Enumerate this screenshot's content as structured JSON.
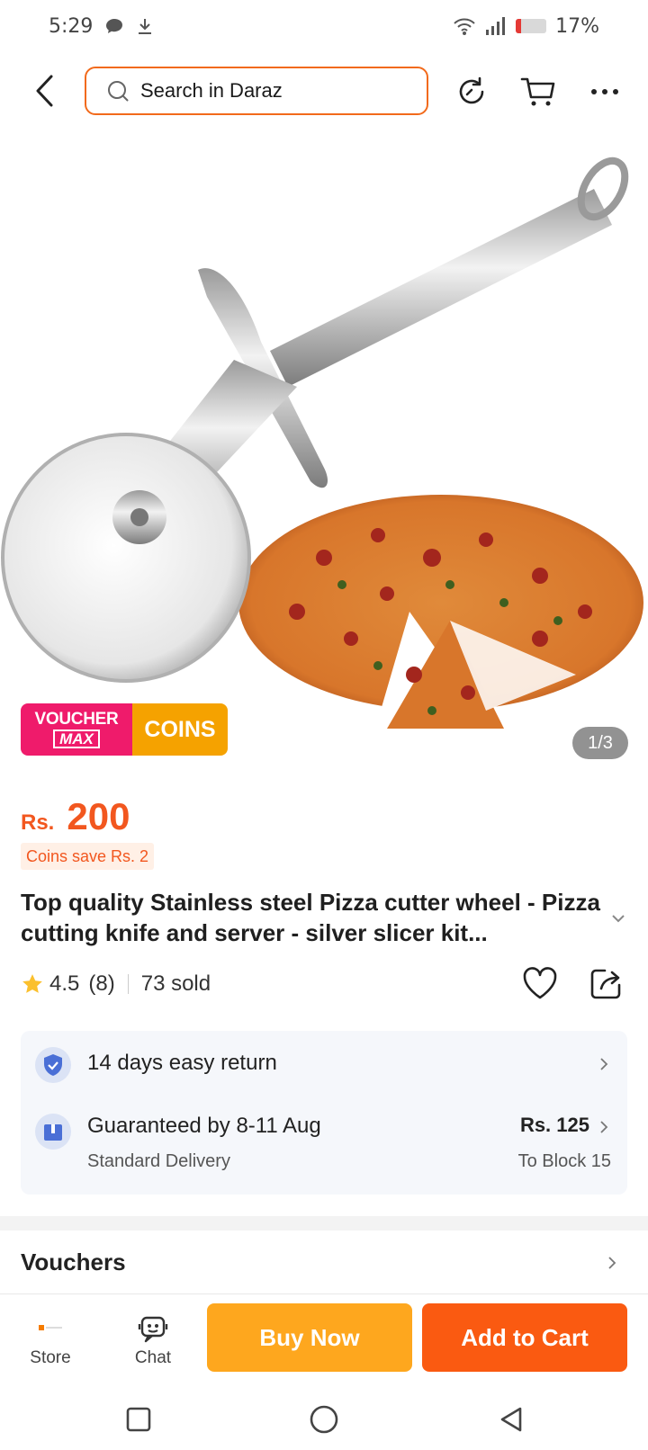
{
  "status_bar": {
    "time": "5:29",
    "battery_pct": "17%",
    "battery_level": 0.17
  },
  "header": {
    "search_placeholder": "Search in Daraz"
  },
  "product": {
    "voucher_badge": {
      "line1": "VOUCHER",
      "line2": "MAX",
      "coins": "COINS"
    },
    "image_counter": "1/3",
    "price_currency": "Rs.",
    "price_value": "200",
    "coins_save": "Coins save Rs. 2",
    "title": "Top quality Stainless steel Pizza cutter wheel - Pizza cutting knife and server - silver slicer kit...",
    "rating": "4.5",
    "rating_count": "(8)",
    "sold": "73 sold"
  },
  "delivery": {
    "return_text": "14 days easy return",
    "guarantee_text": "Guaranteed by 8-11 Aug",
    "delivery_type": "Standard Delivery",
    "delivery_price": "Rs. 125",
    "delivery_to": "To Block 15"
  },
  "vouchers": {
    "title": "Vouchers"
  },
  "bottom_bar": {
    "store_label": "Store",
    "chat_label": "Chat",
    "buy_now": "Buy Now",
    "add_to_cart": "Add to Cart"
  },
  "colors": {
    "accent": "#f2571f",
    "buy_now": "#fea71e",
    "add_to_cart": "#fa5a11",
    "voucher_pink": "#ef1b6b",
    "coins_orange": "#f5a200"
  }
}
